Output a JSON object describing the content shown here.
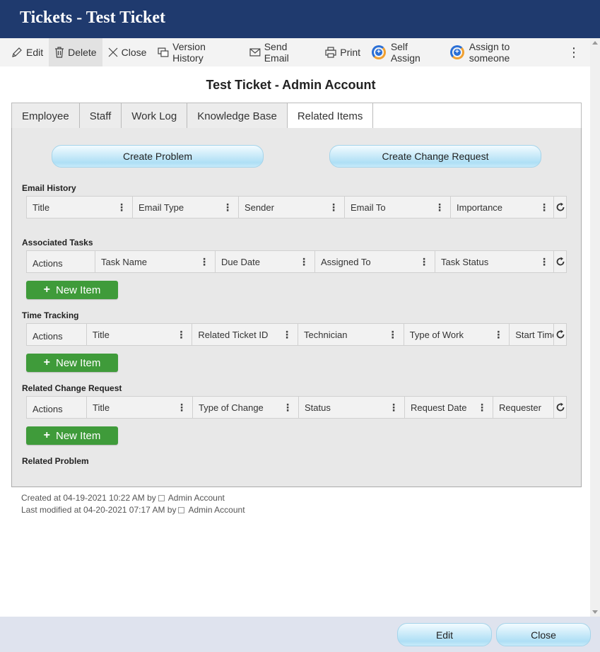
{
  "window": {
    "title": "Tickets - Test Ticket"
  },
  "toolbar": {
    "edit": "Edit",
    "delete": "Delete",
    "close": "Close",
    "version_history": "Version History",
    "send_email": "Send Email",
    "print": "Print",
    "self_assign": "Self Assign",
    "assign_to_someone": "Assign to someone",
    "more": "⋮"
  },
  "form": {
    "title": "Test Ticket - Admin Account"
  },
  "tabs": [
    {
      "label": "Employee"
    },
    {
      "label": "Staff"
    },
    {
      "label": "Work Log"
    },
    {
      "label": "Knowledge Base"
    },
    {
      "label": "Related Items",
      "active": true
    }
  ],
  "actions": {
    "create_problem": "Create Problem",
    "create_change_request": "Create Change Request"
  },
  "sections": {
    "email_history": {
      "label": "Email History",
      "columns": [
        "Title",
        "Email Type",
        "Sender",
        "Email To",
        "Importance"
      ]
    },
    "associated_tasks": {
      "label": "Associated Tasks",
      "columns": [
        "Actions",
        "Task Name",
        "Due Date",
        "Assigned To",
        "Task Status"
      ],
      "new_item": "New Item"
    },
    "time_tracking": {
      "label": "Time Tracking",
      "columns": [
        "Actions",
        "Title",
        "Related Ticket ID",
        "Technician",
        "Type of Work",
        "Start Time"
      ],
      "new_item": "New Item"
    },
    "related_change_request": {
      "label": "Related Change Request",
      "columns": [
        "Actions",
        "Title",
        "Type of Change",
        "Status",
        "Request Date",
        "Requester"
      ],
      "new_item": "New Item"
    },
    "related_problem": {
      "label": "Related Problem"
    }
  },
  "meta": {
    "created_prefix": "Created at 04-19-2021 10:22 AM by",
    "created_user": "Admin Account",
    "modified_prefix": "Last modified at 04-20-2021 07:17 AM by",
    "modified_user": "Admin Account"
  },
  "footer": {
    "edit": "Edit",
    "close": "Close"
  },
  "colors": {
    "header_bg": "#1f3a6e",
    "new_item_green": "#3f9b3a",
    "pill_blue": "#aedff5"
  }
}
